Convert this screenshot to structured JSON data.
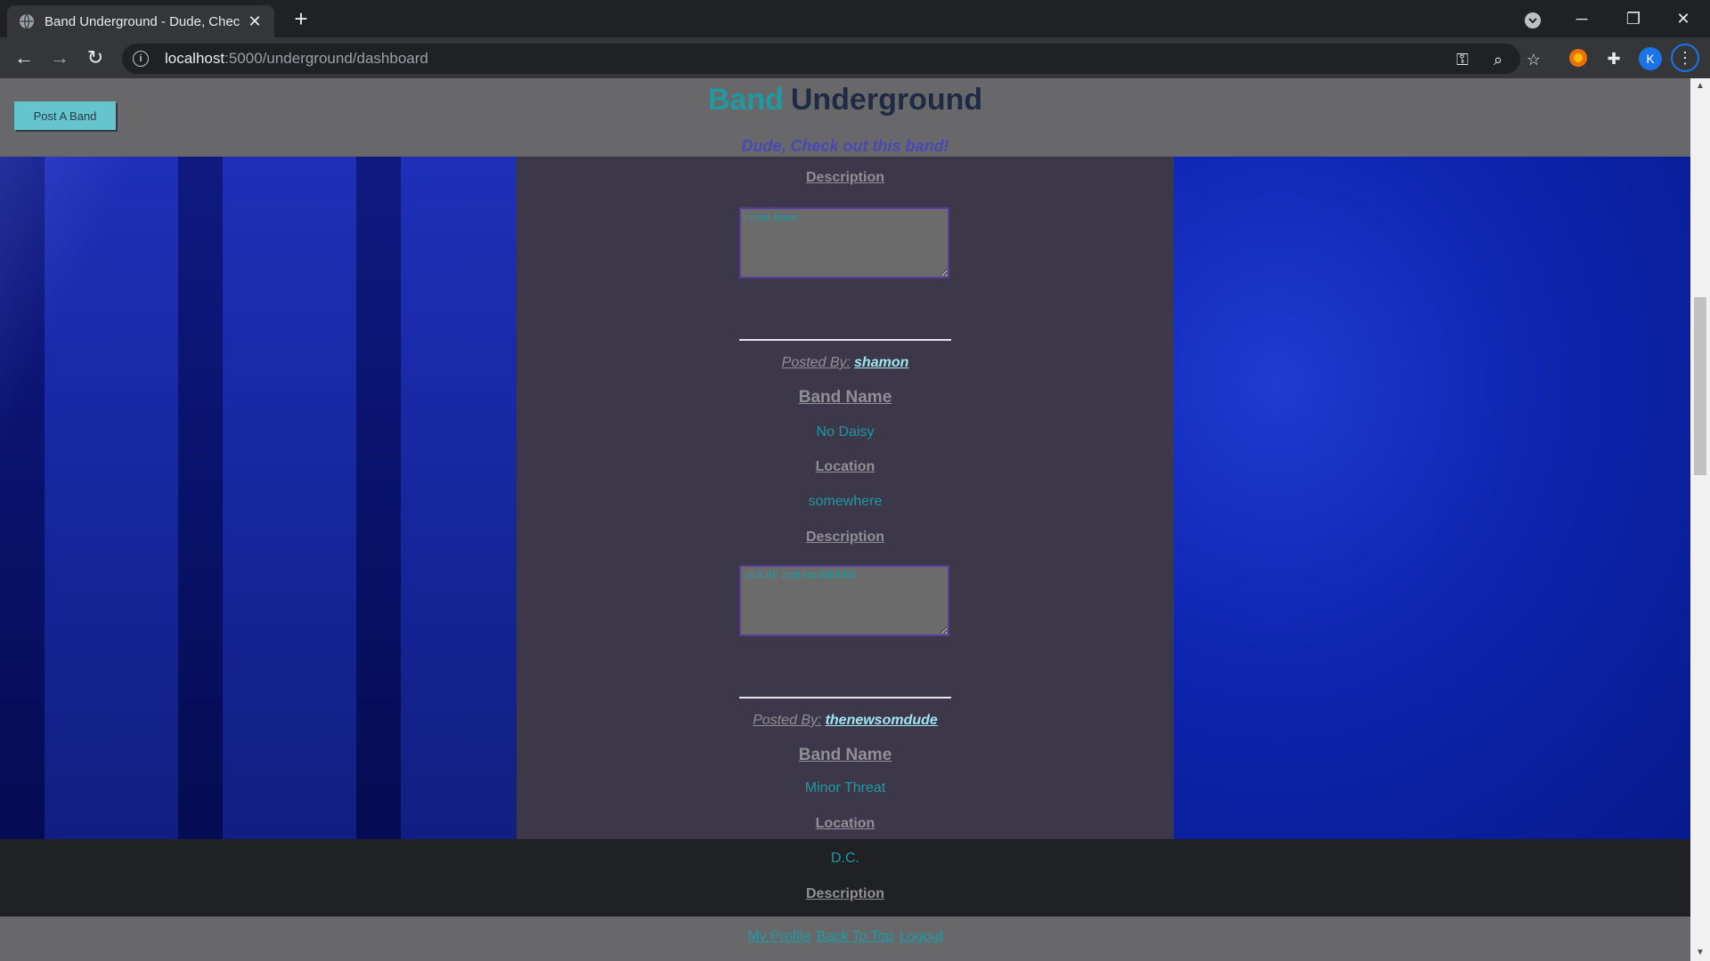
{
  "browser": {
    "tab_title": "Band Underground - Dude, Check out this band!",
    "new_tab": "+",
    "url_host": "localhost",
    "url_path": ":5000/underground/dashboard",
    "profile_initial": "K"
  },
  "header": {
    "post_button": "Post A Band",
    "title_word1": "Band",
    "title_word2": "Underground",
    "tagline": "Dude, Check out this band!"
  },
  "posts": [
    {
      "description_label": "Description",
      "description": "i dont know"
    },
    {
      "posted_by_label": "Posted By:",
      "user": "shamon",
      "band_name_label": "Band Name",
      "band_name": "No Daisy",
      "location_label": "Location",
      "location": "somewhere",
      "description_label": "Description",
      "description": "sick AF and coolllllllllllllll"
    },
    {
      "posted_by_label": "Posted By:",
      "user": "thenewsomdude",
      "band_name_label": "Band Name",
      "band_name": "Minor Threat",
      "location_label": "Location",
      "location": "D.C.",
      "description_label": "Description"
    }
  ],
  "footer": {
    "my_profile": "My Profile",
    "back_to_top": "Back To Top",
    "logout": "Logout"
  },
  "colors": {
    "accent_teal": "#1e9aa2",
    "header_gray": "#68686a",
    "center_column": "#3c3749",
    "background_blue": "#0d25b0"
  }
}
